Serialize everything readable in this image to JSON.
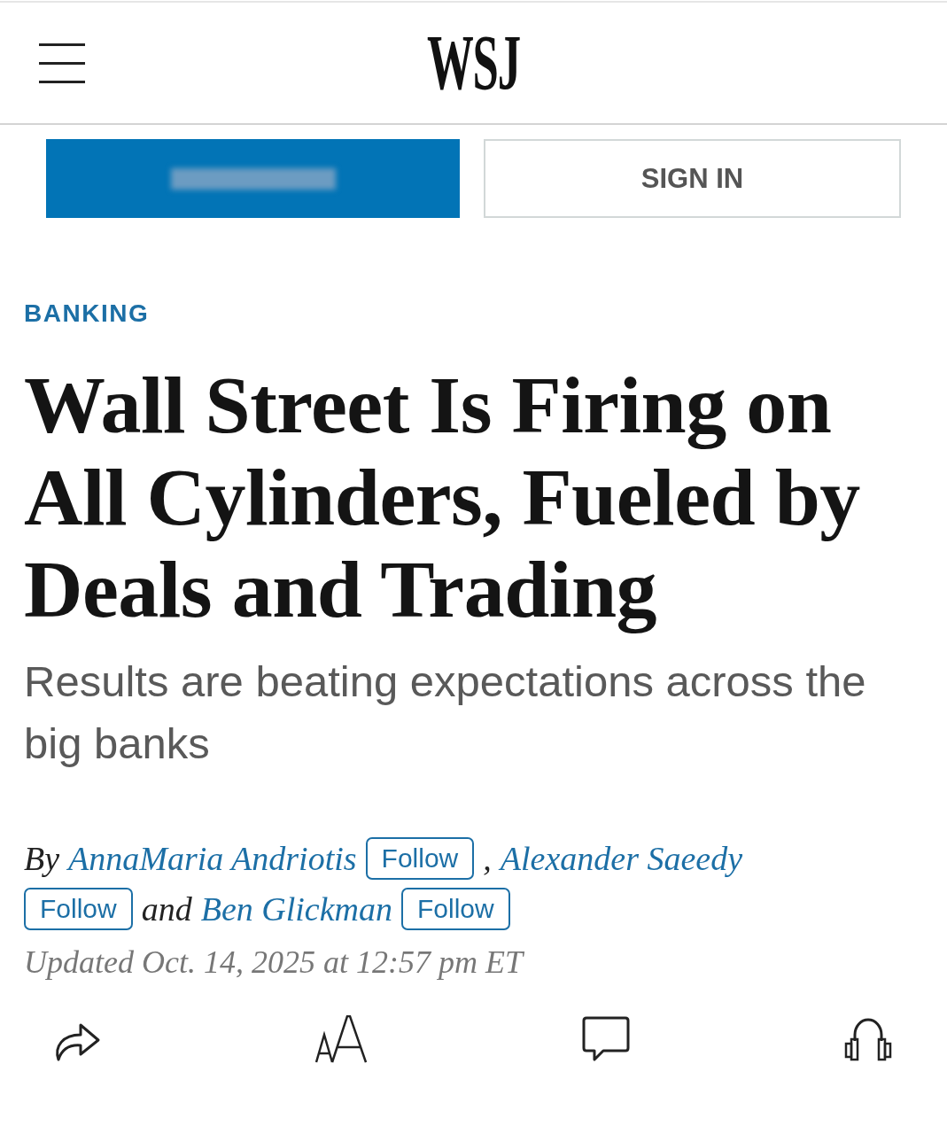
{
  "header": {
    "logo": "WSJ"
  },
  "account_buttons": [
    {
      "kind": "filled"
    },
    {
      "kind": "outlined",
      "label": "SIGN IN"
    }
  ],
  "article": {
    "section": "BANKING",
    "headline": "Wall Street Is Firing on All Cylinders, Fueled by Deals and Trading",
    "subheadline": "Results are beating expectations across the big banks",
    "byline": [
      {
        "kind": "text",
        "text": "By"
      },
      {
        "kind": "author",
        "text": "AnnaMaria Andriotis"
      },
      {
        "kind": "follow",
        "text": "Follow"
      },
      {
        "kind": "text",
        "text": ","
      },
      {
        "kind": "author",
        "text": "Alexander Saeedy"
      },
      {
        "kind": "follow",
        "text": "Follow"
      },
      {
        "kind": "text",
        "text": "and"
      },
      {
        "kind": "author",
        "text": "Ben Glickman"
      },
      {
        "kind": "follow",
        "text": "Follow"
      }
    ],
    "timestamp": "Updated Oct. 14, 2025 at 12:57 pm ET"
  }
}
